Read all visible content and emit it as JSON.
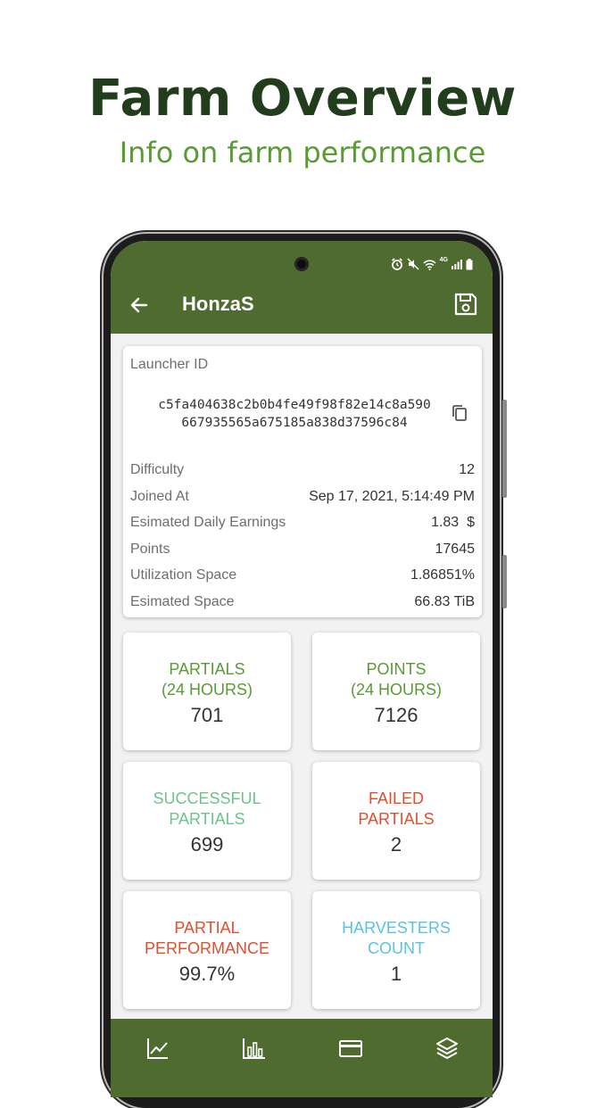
{
  "promo": {
    "title": "Farm Overview",
    "subtitle": "Info on farm performance"
  },
  "appbar": {
    "title": "HonzaS",
    "back_icon": "arrow-left-icon",
    "save_icon": "floppy-disk-icon",
    "background": "#4f6b30"
  },
  "status_bar": {
    "icons": [
      "alarm-icon",
      "mute-icon",
      "wifi-icon",
      "4g-icon",
      "signal-icon",
      "battery-icon"
    ],
    "network_label": "4G"
  },
  "info_card": {
    "launcher_label": "Launcher ID",
    "launcher_id_line1": "c5fa404638c2b0b4fe49f98f82e14c8a590",
    "launcher_id_line2": "667935565a675185a838d37596c84",
    "copy_icon": "copy-icon",
    "rows": [
      {
        "label": "Difficulty",
        "value": "12"
      },
      {
        "label": "Joined At",
        "value": "Sep 17, 2021, 5:14:49 PM"
      },
      {
        "label": "Esimated Daily Earnings",
        "value": "1.83  $"
      },
      {
        "label": "Points",
        "value": "17645"
      },
      {
        "label": "Utilization Space",
        "value": "1.86851%"
      },
      {
        "label": "Esimated Space",
        "value": "66.83 TiB"
      }
    ]
  },
  "stats": [
    {
      "label_line1": "PARTIALS",
      "label_line2": "(24 HOURS)",
      "value": "701",
      "color": "#5a9b35"
    },
    {
      "label_line1": "POINTS",
      "label_line2": "(24 HOURS)",
      "value": "7126",
      "color": "#5a9b35"
    },
    {
      "label_line1": "SUCCESSFUL",
      "label_line2": "PARTIALS",
      "value": "699",
      "color": "#6cc489"
    },
    {
      "label_line1": "FAILED",
      "label_line2": "PARTIALS",
      "value": "2",
      "color": "#e0502e"
    },
    {
      "label_line1": "PARTIAL",
      "label_line2": "PERFORMANCE",
      "value": "99.7%",
      "color": "#e0502e"
    },
    {
      "label_line1": "HARVESTERS",
      "label_line2": "COUNT",
      "value": "1",
      "color": "#5bc3e0"
    }
  ],
  "bottom_nav": {
    "items": [
      "line-chart-icon",
      "bar-chart-icon",
      "wallet-card-icon",
      "layers-icon"
    ]
  }
}
